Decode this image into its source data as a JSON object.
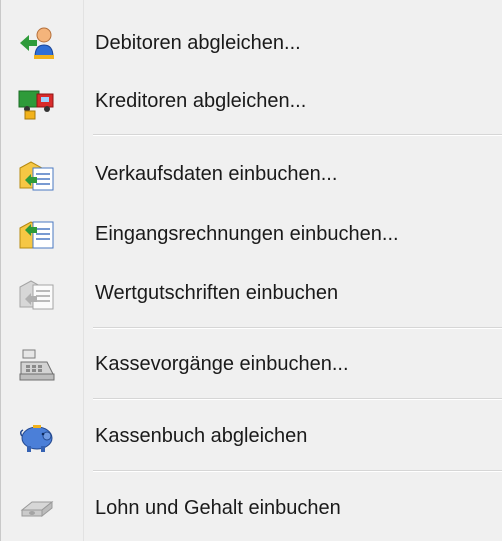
{
  "menu": {
    "items": [
      {
        "label": "Debitoren abgleichen...",
        "icon": "debtor-reconcile-icon"
      },
      {
        "label": "Kreditoren abgleichen...",
        "icon": "creditor-truck-icon"
      },
      {
        "label": "Verkaufsdaten einbuchen...",
        "icon": "sales-import-icon"
      },
      {
        "label": "Eingangsrechnungen einbuchen...",
        "icon": "invoice-import-icon"
      },
      {
        "label": "Wertgutschriften einbuchen",
        "icon": "credit-note-icon"
      },
      {
        "label": "Kassevorgänge einbuchen...",
        "icon": "cash-register-icon"
      },
      {
        "label": "Kassenbuch abgleichen",
        "icon": "piggy-bank-icon"
      },
      {
        "label": "Lohn und Gehalt einbuchen",
        "icon": "payroll-icon"
      }
    ]
  }
}
